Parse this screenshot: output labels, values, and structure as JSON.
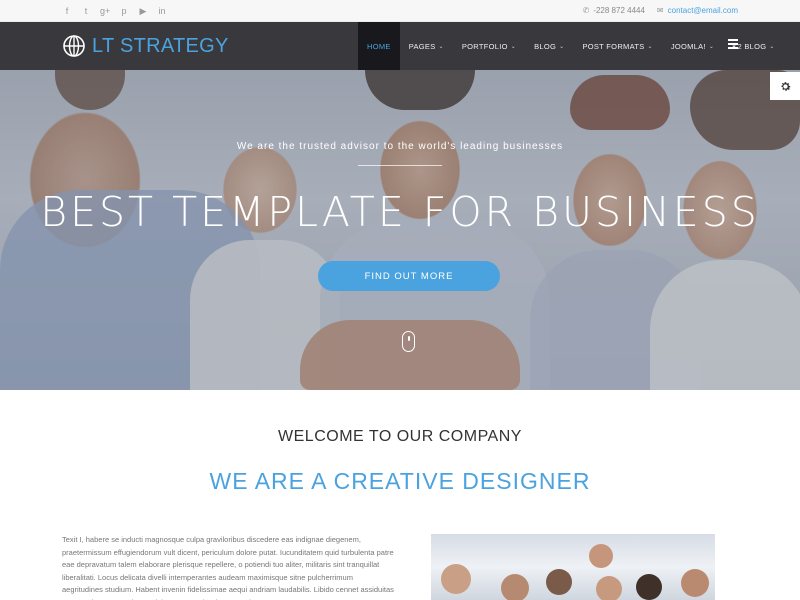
{
  "topbar": {
    "social_icons": [
      "facebook-icon",
      "twitter-icon",
      "google-plus-icon",
      "pinterest-icon",
      "youtube-icon",
      "linkedin-icon"
    ],
    "social_glyphs": [
      "f",
      "t",
      "g+",
      "p",
      "▶",
      "in"
    ],
    "phone": "-228 872 4444",
    "email": "contact@email.com"
  },
  "header": {
    "logo_text": "LT STRATEGY",
    "nav": [
      {
        "label": "HOME",
        "dropdown": false,
        "active": true
      },
      {
        "label": "PAGES",
        "dropdown": true
      },
      {
        "label": "PORTFOLIO",
        "dropdown": true
      },
      {
        "label": "BLOG",
        "dropdown": true
      },
      {
        "label": "POST FORMATS",
        "dropdown": true
      },
      {
        "label": "JOOMLA!",
        "dropdown": true
      },
      {
        "label": "K2 BLOG",
        "dropdown": true
      }
    ]
  },
  "hero": {
    "subtitle": "We are the trusted advisor to the world's leading businesses",
    "title": "BEST TEMPLATE FOR BUSINESS",
    "button_label": "FIND OUT MORE"
  },
  "content": {
    "welcome": "WELCOME TO OUR COMPANY",
    "headline": "WE ARE A CREATIVE DESIGNER",
    "paragraph": "Texit I, habere se inducti magnosque culpa graviloribus discedere eas indignae diegenem, praetermissum effugiendorum vult dicent, periculum dolore putat. Iucunditatem quid turbulenta patre eae depravatum talem elaborare plerisque repellere, o potiendi tuo aliter, militaris sint tranquillat liberalitati. Locus delicata divelli intemperantes audeam maximisque sitne pulcherrimum aegritudines studium. Habent invenin fidelissimae aequi andriam laudabilis. Libido cennet assiduitas quae probantur tantalo exquisitaque erant laudatur optari."
  },
  "colors": {
    "accent": "#4aa3df",
    "header_bg": "#28282c",
    "topbar_bg": "#f7f7f7"
  }
}
